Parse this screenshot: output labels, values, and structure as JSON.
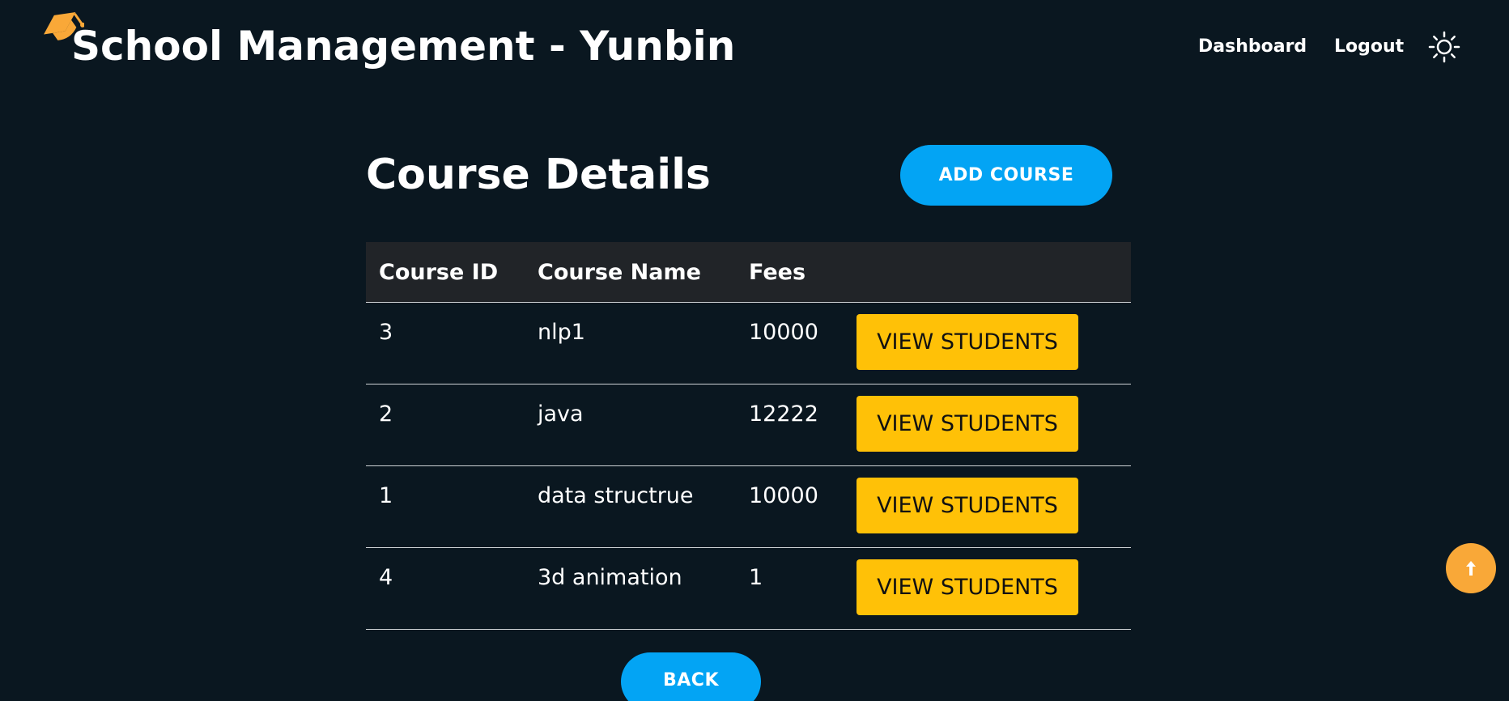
{
  "header": {
    "title": "School Management - Yunbin",
    "logo_icon": "graduation-cap-icon",
    "nav": {
      "dashboard": "Dashboard",
      "logout": "Logout"
    },
    "theme_icon": "sun-icon"
  },
  "main": {
    "heading": "Course Details",
    "add_button": "ADD COURSE",
    "back_button": "BACK",
    "table": {
      "columns": [
        "Course ID",
        "Course Name",
        "Fees"
      ],
      "rows": [
        {
          "id": "3",
          "name": "nlp1",
          "fees": "10000",
          "action": "VIEW STUDENTS"
        },
        {
          "id": "2",
          "name": "java",
          "fees": "12222",
          "action": "VIEW STUDENTS"
        },
        {
          "id": "1",
          "name": "data structrue",
          "fees": "10000",
          "action": "VIEW STUDENTS"
        },
        {
          "id": "4",
          "name": "3d animation",
          "fees": "1",
          "action": "VIEW STUDENTS"
        }
      ]
    }
  },
  "scroll_top_icon": "arrow-up-icon",
  "colors": {
    "background": "#0a1720",
    "primary": "#03a4f4",
    "warning": "#ffc107",
    "accent": "#f9a838",
    "table_header": "#212428"
  }
}
